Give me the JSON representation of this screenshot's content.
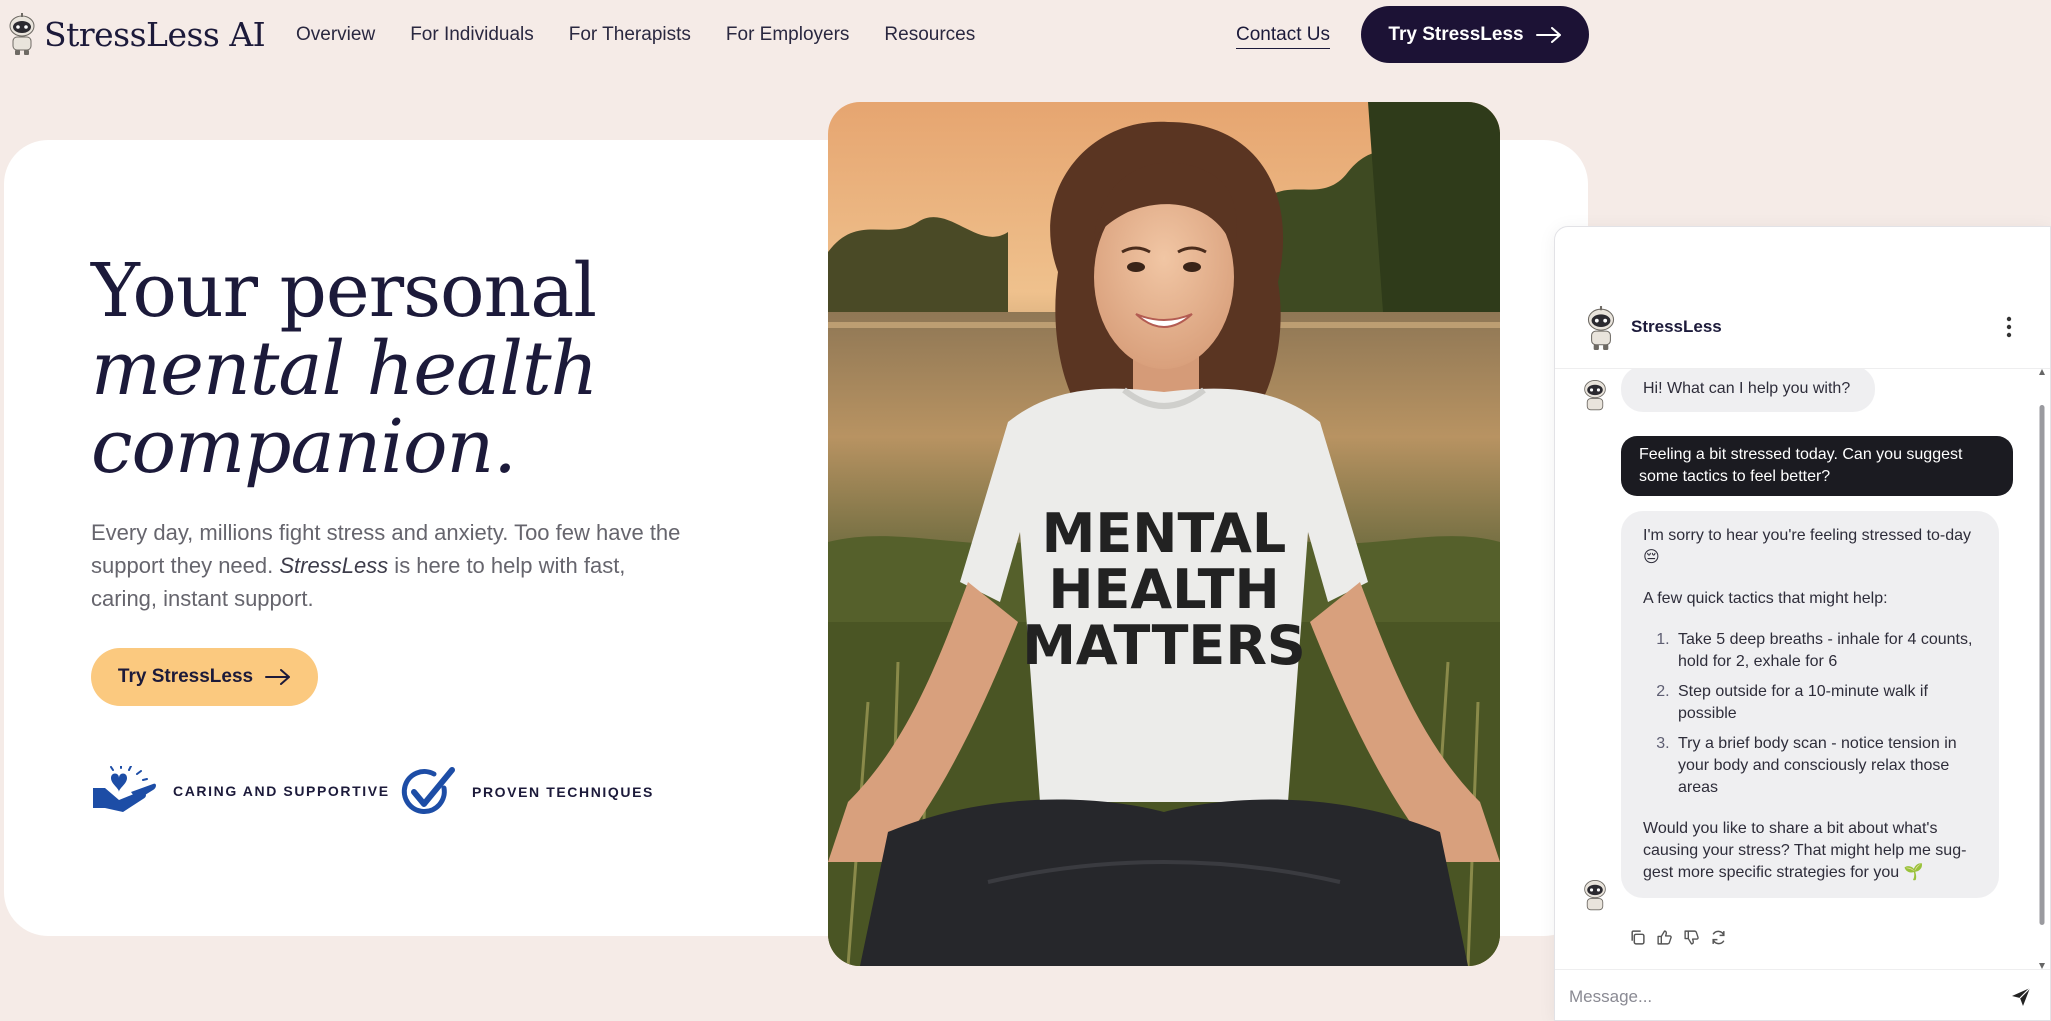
{
  "nav": {
    "logo_text": "StressLess AI",
    "links": [
      "Overview",
      "For Individuals",
      "For Therapists",
      "For Employers",
      "Resources"
    ],
    "contact": "Contact Us",
    "cta": "Try StressLess"
  },
  "hero": {
    "title_line1": "Your personal",
    "title_line2": "mental health",
    "title_line3": "companion.",
    "sub_before": "Every day, millions fight stress and anxiety. Too few have the support they need. ",
    "sub_em": "StressLess",
    "sub_after": " is here to help with fast, caring, instant support.",
    "cta": "Try StressLess",
    "features": [
      "CARING AND SUPPORTIVE",
      "PROVEN TECHNIQUES"
    ]
  },
  "photo": {
    "shirt_text": [
      "MENTAL",
      "HEALTH",
      "MATTERS"
    ]
  },
  "chat": {
    "name": "StressLess",
    "greeting": "Hi! What can I help you with?",
    "user_msg": "Feeling a bit stressed today. Can you suggest some tactics to feel better?",
    "reply_intro": "I'm sorry to hear you're feeling stressed to-day 😔",
    "reply_lead": "A few quick tactics that might help:",
    "reply_items": [
      "Take 5 deep breaths - inhale for 4 counts, hold for 2, exhale for 6",
      "Step outside for a 10-minute walk if possible",
      "Try a brief body scan - notice tension in your body and consciously relax those areas"
    ],
    "reply_outro": "Would you like to share a bit about what's causing your stress? That might help me sug-gest more specific strategies for you 🌱",
    "input_placeholder": "Message..."
  },
  "colors": {
    "page_bg": "#f5ebe7",
    "dark": "#1c1235",
    "accent_peach": "#fbc97f",
    "icon_blue": "#1d4da6"
  }
}
